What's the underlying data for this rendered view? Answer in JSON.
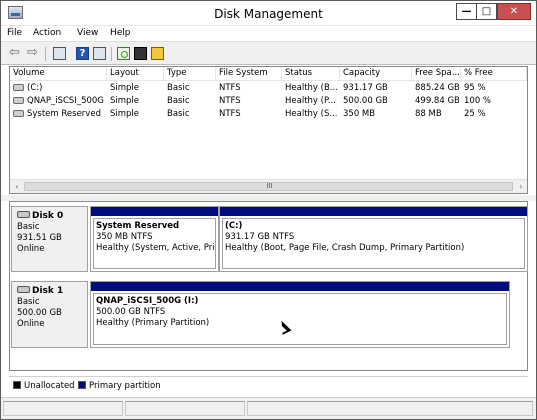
{
  "window": {
    "title": "Disk Management",
    "minimize_glyph": "—",
    "maximize_glyph": "□",
    "close_glyph": "✕"
  },
  "menu": [
    "File",
    "Action",
    "View",
    "Help"
  ],
  "toolbar": {
    "icons": [
      "back-arrow-icon",
      "forward-arrow-icon",
      "console-tree-icon",
      "help-icon",
      "show-pane-icon",
      "refresh-icon",
      "properties-icon",
      "disk-settings-icon"
    ],
    "back_glyph": "⇦",
    "forward_glyph": "⇨",
    "help_glyph": "?"
  },
  "volumes": {
    "columns": [
      "Volume",
      "Layout",
      "Type",
      "File System",
      "Status",
      "Capacity",
      "Free Spa...",
      "% Free"
    ],
    "rows": [
      {
        "volume": "(C:)",
        "layout": "Simple",
        "type": "Basic",
        "fs": "NTFS",
        "status": "Healthy (B...",
        "capacity": "931.17 GB",
        "free": "885.24 GB",
        "pct": "95 %"
      },
      {
        "volume": "QNAP_iSCSI_500G ...",
        "layout": "Simple",
        "type": "Basic",
        "fs": "NTFS",
        "status": "Healthy (P...",
        "capacity": "500.00 GB",
        "free": "499.84 GB",
        "pct": "100 %"
      },
      {
        "volume": "System Reserved",
        "layout": "Simple",
        "type": "Basic",
        "fs": "NTFS",
        "status": "Healthy (S...",
        "capacity": "350 MB",
        "free": "88 MB",
        "pct": "25 %"
      }
    ],
    "scroll_left_glyph": "‹",
    "scroll_right_glyph": "›",
    "scroll_grip": "III"
  },
  "disks": [
    {
      "name": "Disk 0",
      "type": "Basic",
      "size": "931.51 GB",
      "state": "Online",
      "partitions": [
        {
          "title": "System Reserved",
          "detail": "350 MB NTFS",
          "status": "Healthy (System, Active, Prim"
        },
        {
          "title": "(C:)",
          "detail": "931.17 GB NTFS",
          "status": "Healthy (Boot, Page File, Crash Dump, Primary Partition)"
        }
      ]
    },
    {
      "name": "Disk 1",
      "type": "Basic",
      "size": "500.00 GB",
      "state": "Online",
      "partitions": [
        {
          "title": "QNAP_iSCSI_500G  (I:)",
          "detail": "500.00 GB NTFS",
          "status": "Healthy (Primary Partition)"
        }
      ]
    }
  ],
  "legend": [
    {
      "label": "Unallocated",
      "color": "#000000"
    },
    {
      "label": "Primary partition",
      "color": "#000c80"
    }
  ],
  "colors": {
    "partition_bar": "#000c80",
    "close_button": "#c75050"
  }
}
